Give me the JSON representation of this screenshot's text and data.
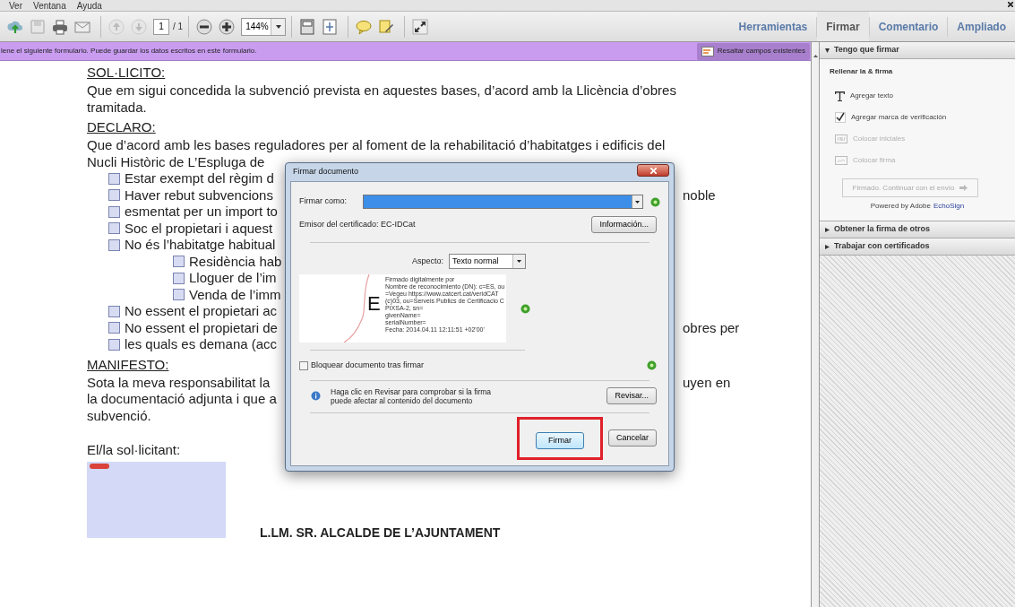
{
  "menu": [
    "Ver",
    "Ventana",
    "Ayuda"
  ],
  "toolbar": {
    "page": "1",
    "page_total": "/ 1",
    "zoom": "144%"
  },
  "tabs": [
    {
      "label": "Herramientas",
      "selected": false
    },
    {
      "label": "Firmar",
      "selected": true
    },
    {
      "label": "Comentario",
      "selected": false
    },
    {
      "label": "Ampliado",
      "selected": false
    }
  ],
  "form_bar": {
    "message": "lene el siguiente formulario. Puede guardar los datos escritos en este formulario.",
    "button": "Resaltar campos existentes"
  },
  "document": {
    "lines": [
      {
        "kind": "heading",
        "text": "SOL·LICITO:"
      },
      {
        "kind": "para",
        "text": "Que em sigui concedida la subvenció prevista en aquestes bases, d’acord amb la Llicència d’obres"
      },
      {
        "kind": "para",
        "text": "tramitada."
      },
      {
        "kind": "heading",
        "text": "DECLARO:"
      },
      {
        "kind": "para",
        "text": "Que d’acord amb les bases reguladores per al foment de la rehabilitació d’habitatges i edificis del"
      },
      {
        "kind": "para",
        "text": "Nucli Històric de L’Espluga de"
      },
      {
        "kind": "check",
        "text": "Estar exempt del règim d",
        "checked": false
      },
      {
        "kind": "check",
        "text": "Haver rebut subvencions",
        "checked": false,
        "right": "noble"
      },
      {
        "kind": "check",
        "text": "esmentat per un import to",
        "checked": false
      },
      {
        "kind": "check",
        "text": "Soc el propietari i aquest",
        "checked": false
      },
      {
        "kind": "check",
        "text": "No és l’habitatge habitual",
        "checked": false
      },
      {
        "kind": "subcheck",
        "text": "Residència hab",
        "checked": false
      },
      {
        "kind": "subcheck",
        "text": "Lloguer de l’im",
        "checked": false
      },
      {
        "kind": "subcheck",
        "text": "Venda de l’imm",
        "checked": false
      },
      {
        "kind": "check",
        "text": "No essent el propietari ac",
        "checked": false
      },
      {
        "kind": "check",
        "text": "No essent el propietari de",
        "checked": false,
        "right": "obres per"
      },
      {
        "kind": "check",
        "text": "les quals es demana (acc",
        "checked": false
      },
      {
        "kind": "heading",
        "text": "MANIFESTO:"
      },
      {
        "kind": "para",
        "text": "Sota la meva responsabilitat la",
        "right": "uyen en"
      },
      {
        "kind": "para",
        "text": "la documentació adjunta i que a"
      },
      {
        "kind": "para",
        "text": "subvenció."
      },
      {
        "kind": "gap"
      },
      {
        "kind": "para",
        "text": "El/la sol·licitant:"
      }
    ],
    "addressee": "L.LM. SR. ALCALDE DE L’AJUNTAMENT"
  },
  "dialog": {
    "title": "Firmar documento",
    "sign_as_label": "Firmar como:",
    "issuer": "Emisor del certificado: EC-IDCat",
    "info_button": "Información...",
    "appearance_label": "Aspecto:",
    "appearance": "Texto normal",
    "preview": {
      "letter": "E",
      "lines": [
        "Firmado digitalmente por",
        "Nombre de reconocimiento (DN): c=ES, ou=Vegeu https://www.catcert.cat/veridCAT (c)03, ou=Serveis Publics de Certificacio CPIXSA-2, sn=",
        "givenName=",
        "serialNumber=",
        "Fecha: 2014.04.11 12:11:51 +02'00'"
      ]
    },
    "lock": {
      "label": "Bloquear documento tras firmar",
      "checked": false
    },
    "review_text": "Haga clic en Revisar para comprobar si la firma puede afectar al contenido del documento",
    "review_button": "Revisar...",
    "sign_button": "Firmar",
    "cancel_button": "Cancelar"
  },
  "panel": {
    "sections": [
      {
        "title": "Tengo que firmar",
        "expanded": true,
        "subtitle": "Rellenar la & firma",
        "items": [
          {
            "kind": "text",
            "label": "Agregar texto",
            "disabled": false
          },
          {
            "kind": "check",
            "label": "Agregar marca de verificación",
            "disabled": false
          },
          {
            "kind": "initials",
            "label": "Colocar iniciales",
            "disabled": true
          },
          {
            "kind": "signature",
            "label": "Colocar firma",
            "disabled": true
          }
        ],
        "send_button": {
          "label": "Firmado. Continuar con el envío",
          "disabled": true
        },
        "powered": "Powered by Adobe",
        "powered_link": "EchoSign"
      },
      {
        "title": "Obtener la firma de otros",
        "expanded": false
      },
      {
        "title": "Trabajar con certificados",
        "expanded": false
      }
    ]
  }
}
